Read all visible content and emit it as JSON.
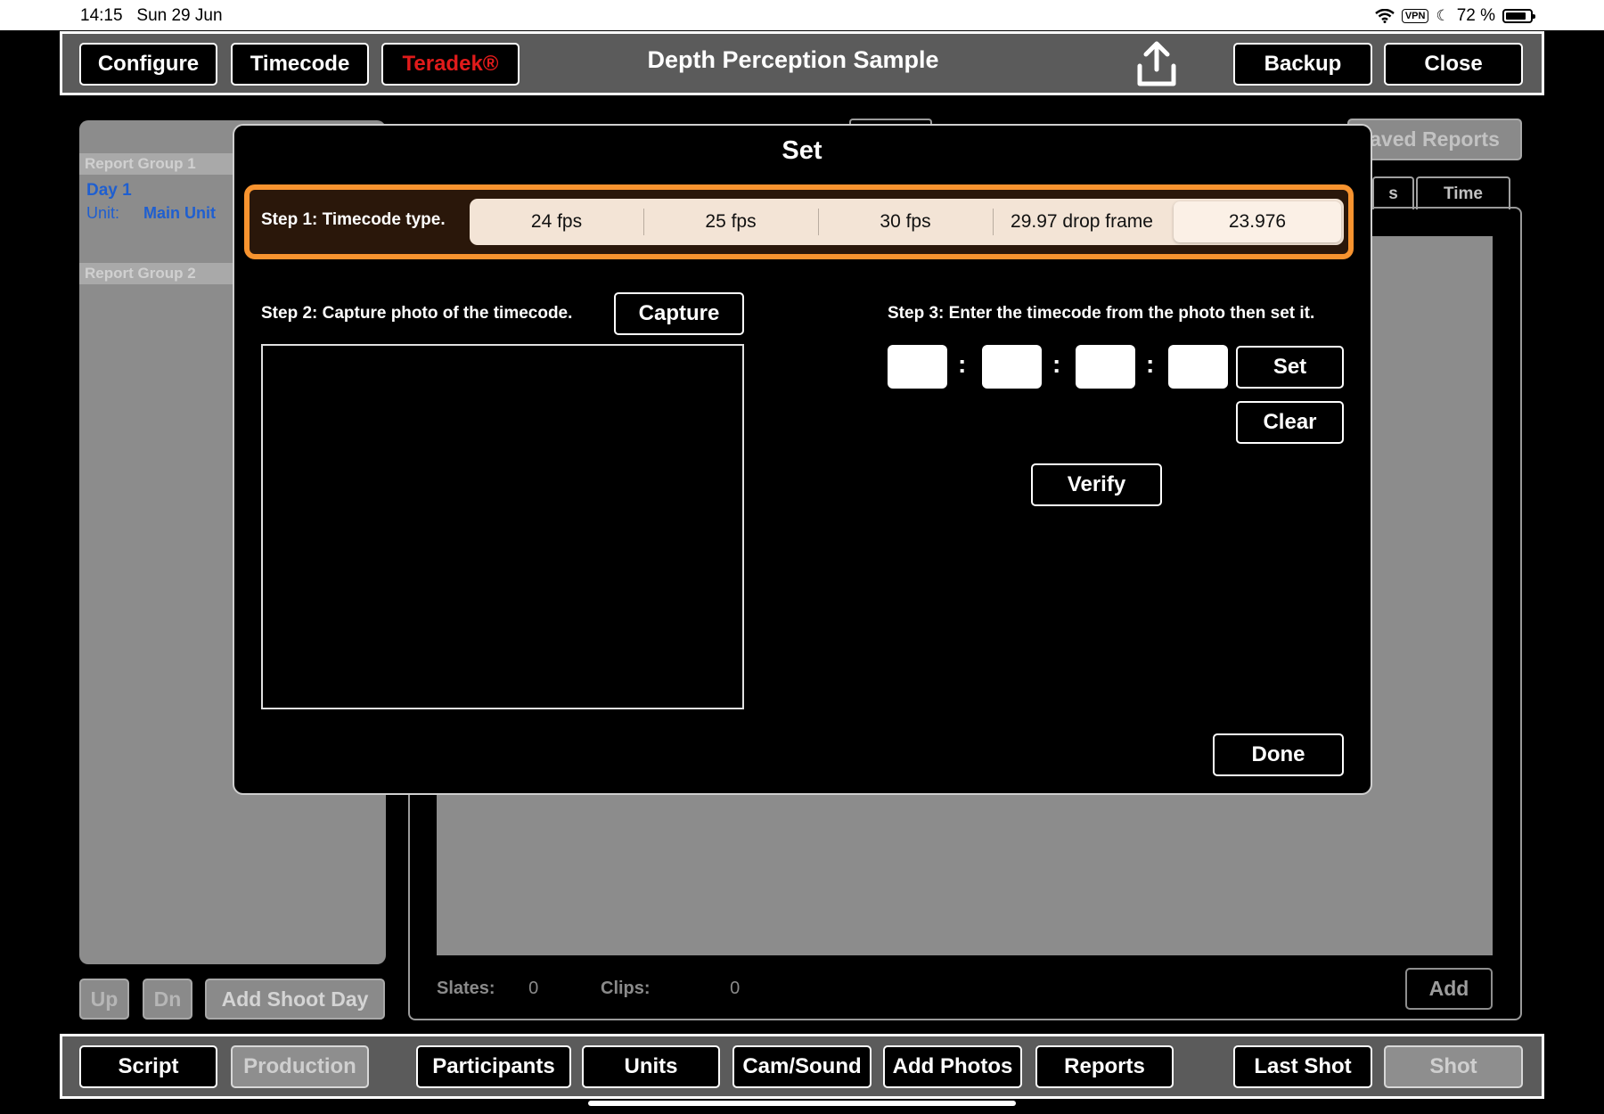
{
  "status": {
    "time": "14:15",
    "date": "Sun 29 Jun",
    "vpn": "VPN",
    "battery": "72 %"
  },
  "top_bar": {
    "configure": "Configure",
    "timecode": "Timecode",
    "teradek": "Teradek®",
    "title": "Depth Perception Sample",
    "backup": "Backup",
    "close": "Close"
  },
  "background": {
    "group1": "Report Group 1",
    "day": "Day 1",
    "unit_label": "Unit:",
    "unit_value": "Main Unit",
    "group2": "Report Group 2",
    "saved_reports": "aved Reports",
    "tab_partial": "s",
    "tab_time": "Time",
    "up": "Up",
    "dn": "Dn",
    "add_shoot_day": "Add Shoot Day",
    "slates_label": "Slates:",
    "slates_value": "0",
    "clips_label": "Clips:",
    "clips_value": "0",
    "add": "Add"
  },
  "modal": {
    "title": "Set",
    "step1_label": "Step 1: Timecode type.",
    "fps_options": [
      "24 fps",
      "25 fps",
      "30 fps",
      "29.97 drop frame",
      "23.976"
    ],
    "selected_fps": "23.976",
    "step2_label": "Step 2: Capture photo of the timecode.",
    "capture": "Capture",
    "step3_label": "Step 3: Enter the timecode from the photo then set it.",
    "timecode_fields": [
      "",
      "",
      "",
      ""
    ],
    "separator": ":",
    "set": "Set",
    "clear": "Clear",
    "verify": "Verify",
    "done": "Done"
  },
  "bottom_bar": {
    "script": "Script",
    "production": "Production",
    "participants": "Participants",
    "units": "Units",
    "cam_sound": "Cam/Sound",
    "add_photos": "Add Photos",
    "reports": "Reports",
    "last_shot": "Last Shot",
    "shot": "Shot"
  },
  "colors": {
    "accent_orange": "#f7932f",
    "teradek_red": "#e01b1b",
    "link_blue": "#1f5fd0",
    "segment_bg": "#f3e4d6"
  }
}
